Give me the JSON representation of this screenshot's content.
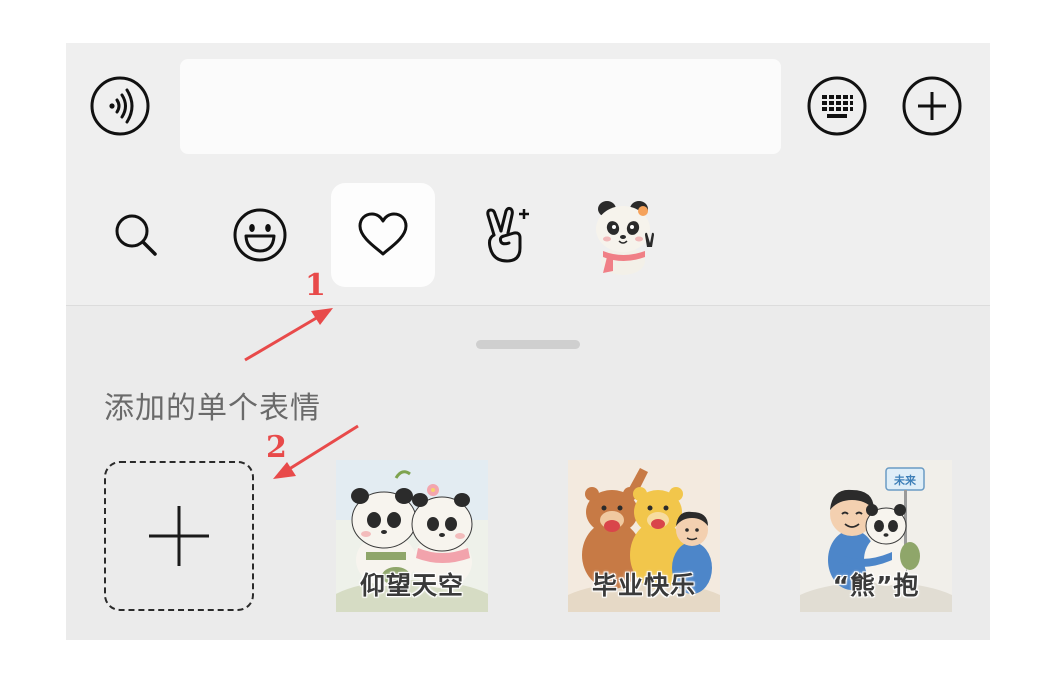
{
  "toolbar": {
    "voice_icon": "voice-icon",
    "input_value": "",
    "keyboard_icon": "keyboard-icon",
    "plus_icon": "plus-icon"
  },
  "emoji_tabs": [
    {
      "icon": "search-icon",
      "active": false
    },
    {
      "icon": "smiley-icon",
      "active": false
    },
    {
      "icon": "heart-icon",
      "active": true
    },
    {
      "icon": "victory-hand-icon",
      "active": false
    },
    {
      "icon": "panda-sticker-icon",
      "active": false
    }
  ],
  "section": {
    "title": "添加的单个表情"
  },
  "stickers": [
    {
      "caption": "仰望天空"
    },
    {
      "caption": "毕业快乐"
    },
    {
      "caption": "“熊”抱",
      "sign": "未来"
    }
  ],
  "annotations": {
    "label_1": "1",
    "label_2": "2",
    "color": "#e84a4a"
  }
}
